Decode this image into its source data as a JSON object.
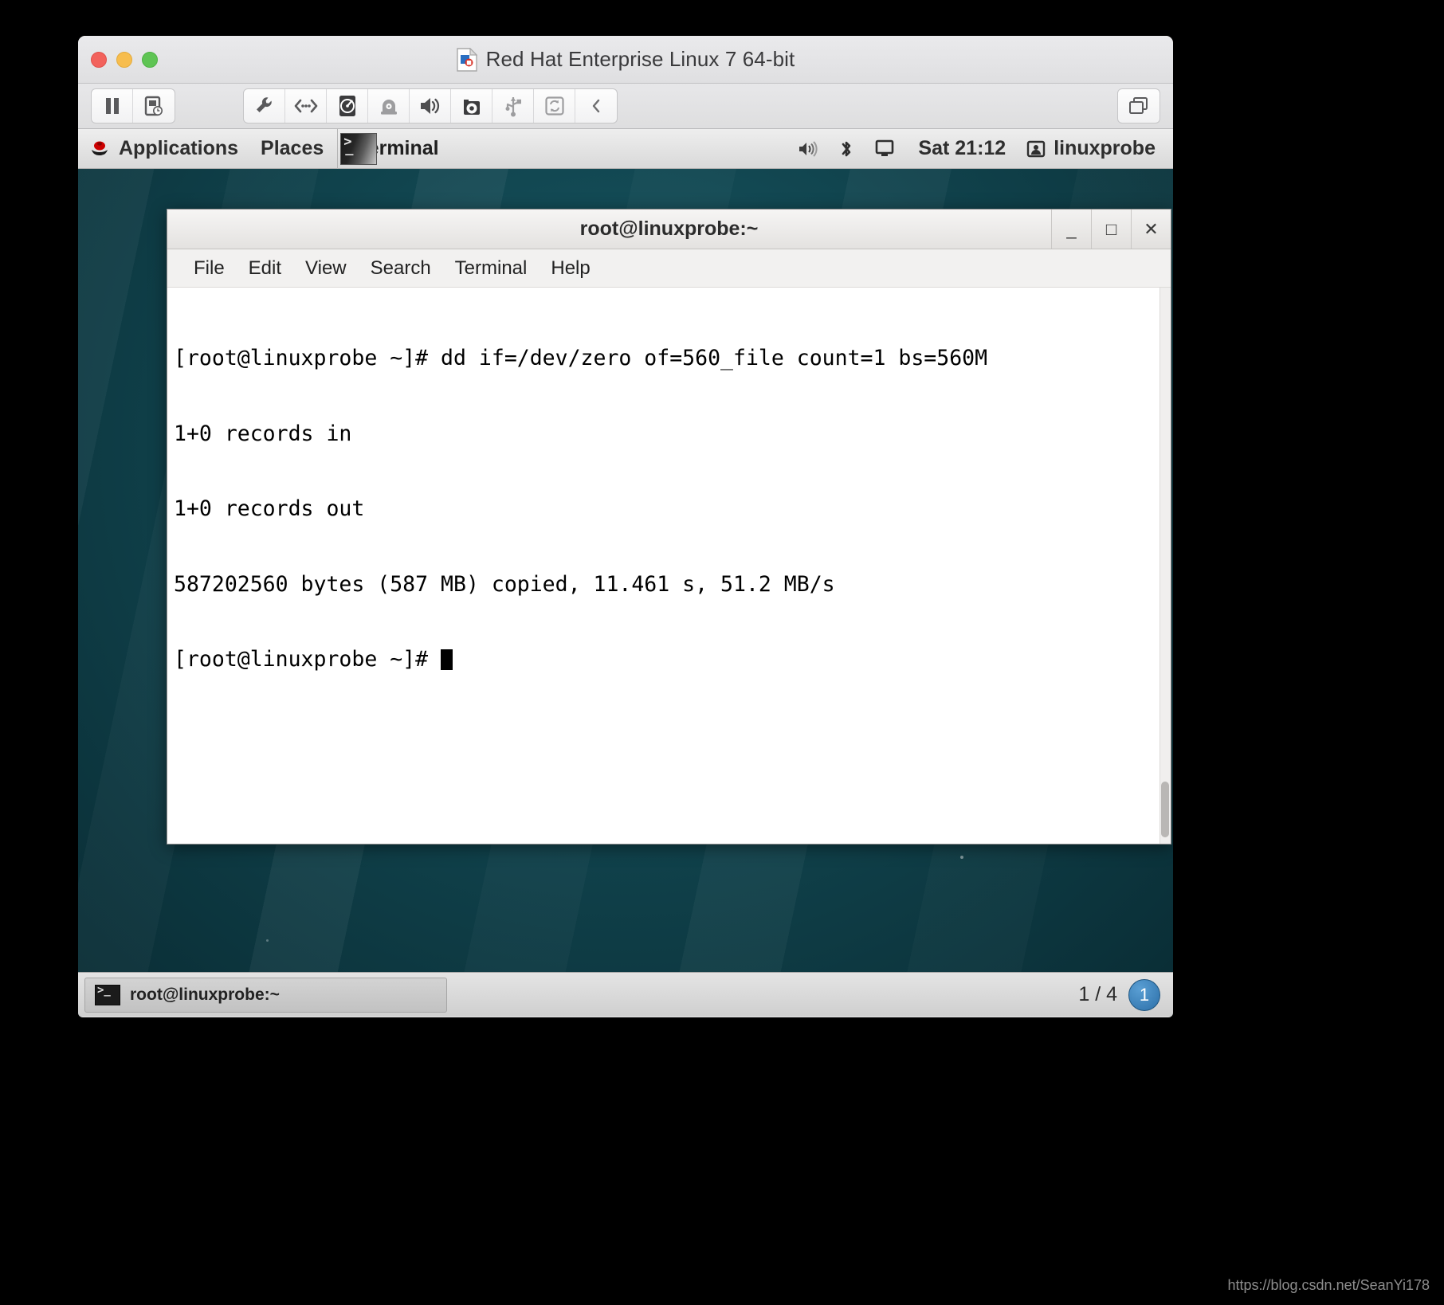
{
  "vm": {
    "title": "Red Hat Enterprise Linux 7 64-bit",
    "title_icon": "vmware-document-icon",
    "traffic_lights": [
      {
        "name": "close-window-button",
        "color": "#f2625c"
      },
      {
        "name": "minimize-window-button",
        "color": "#f7bd4e"
      },
      {
        "name": "maximize-window-button",
        "color": "#5fc454"
      }
    ],
    "toolbar": {
      "left_group": [
        {
          "name": "pause-button",
          "icon": "pause-icon",
          "label": "Pause"
        },
        {
          "name": "snapshot-button",
          "icon": "snapshot-clock-icon",
          "label": "Snapshots"
        }
      ],
      "device_group": [
        {
          "name": "settings-button",
          "icon": "wrench-icon",
          "label": "Settings"
        },
        {
          "name": "network-button",
          "icon": "network-icon",
          "label": "Network Adapter"
        },
        {
          "name": "harddisk-button",
          "icon": "hard-disk-icon",
          "label": "Hard Disk"
        },
        {
          "name": "cddvd-button",
          "icon": "cd-dvd-icon",
          "label": "CD/DVD"
        },
        {
          "name": "sound-button",
          "icon": "speaker-icon",
          "label": "Sound Card"
        },
        {
          "name": "camera-button",
          "icon": "camera-icon",
          "label": "Camera"
        },
        {
          "name": "usb-button",
          "icon": "usb-icon",
          "label": "USB Devices"
        },
        {
          "name": "sharing-button",
          "icon": "sync-sharing-icon",
          "label": "Sharing"
        },
        {
          "name": "collapse-toolbar-button",
          "icon": "chevron-left-icon",
          "label": "Collapse"
        }
      ],
      "right_group": [
        {
          "name": "fullscreen-button",
          "icon": "fullscreen-windows-icon",
          "label": "Full Screen"
        }
      ]
    }
  },
  "gnome_panel": {
    "applications_label": "Applications",
    "places_label": "Places",
    "window_label": "Terminal",
    "tray": [
      {
        "name": "volume-icon",
        "label": "Volume"
      },
      {
        "name": "bluetooth-icon",
        "label": "Bluetooth"
      },
      {
        "name": "display-icon",
        "label": "Display"
      }
    ],
    "clock": "Sat 21:12",
    "user_name": "linuxprobe",
    "user_icon": "user-account-icon"
  },
  "terminal": {
    "title": "root@linuxprobe:~",
    "window_buttons": [
      {
        "name": "terminal-minimize-button",
        "glyph": "_"
      },
      {
        "name": "terminal-maximize-button",
        "glyph": "□"
      },
      {
        "name": "terminal-close-button",
        "glyph": "✕"
      }
    ],
    "menu": [
      {
        "name": "menu-file",
        "label": "File"
      },
      {
        "name": "menu-edit",
        "label": "Edit"
      },
      {
        "name": "menu-view",
        "label": "View"
      },
      {
        "name": "menu-search",
        "label": "Search"
      },
      {
        "name": "menu-terminal",
        "label": "Terminal"
      },
      {
        "name": "menu-help",
        "label": "Help"
      }
    ],
    "lines": [
      "[root@linuxprobe ~]# dd if=/dev/zero of=560_file count=1 bs=560M",
      "1+0 records in",
      "1+0 records out",
      "587202560 bytes (587 MB) copied, 11.461 s, 51.2 MB/s"
    ],
    "prompt": "[root@linuxprobe ~]# "
  },
  "taskbar": {
    "window_item_label": "root@linuxprobe:~",
    "workspace_indicator": "1 / 4",
    "workspace_badge": "1"
  },
  "watermark": "https://blog.csdn.net/SeanYi178",
  "colors": {
    "desktop_teal": "#0e3a43",
    "panel_grey": "#e4e4e4",
    "terminal_bg": "#ffffff",
    "terminal_fg": "#000000",
    "accent_blue": "#2c6fa8"
  }
}
